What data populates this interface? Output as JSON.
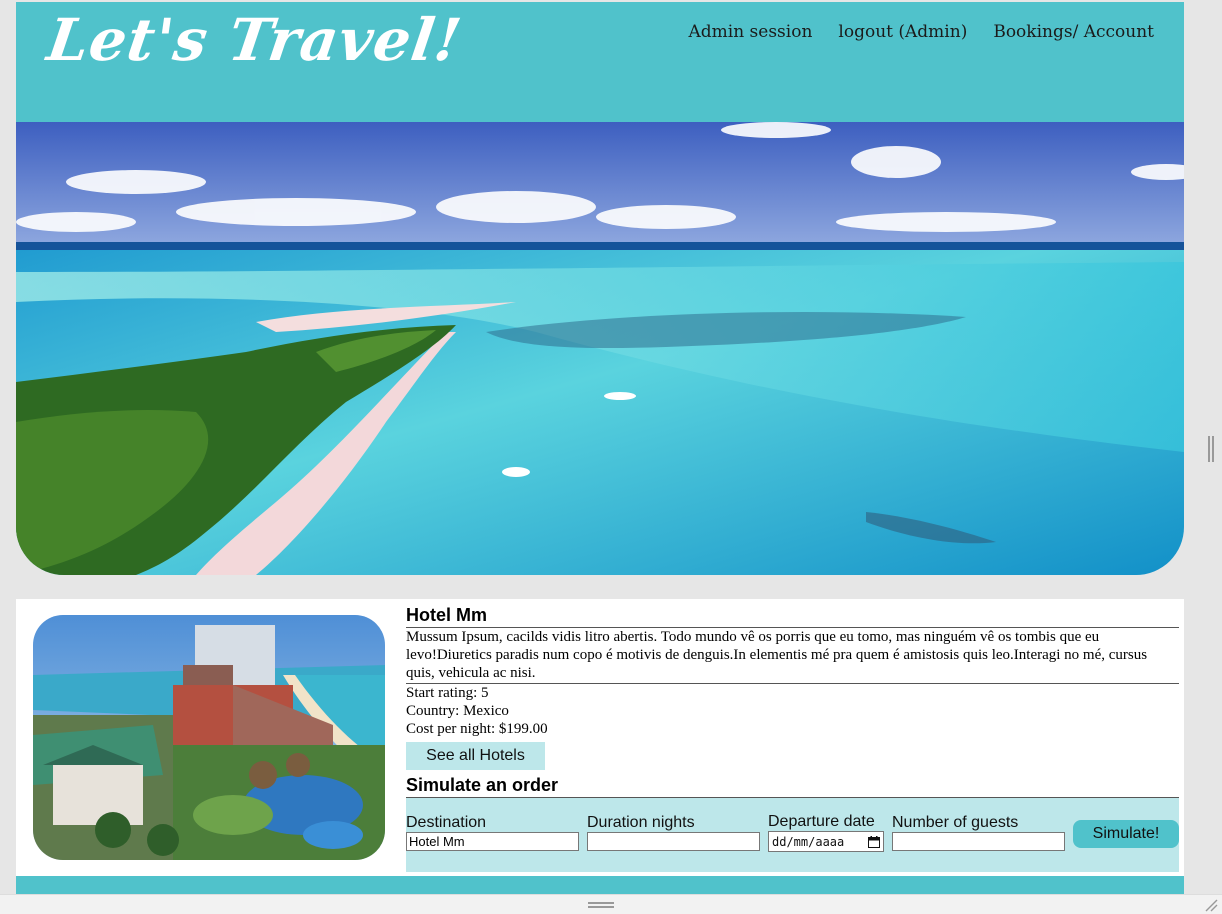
{
  "header": {
    "logo": "Let's Travel!",
    "nav": [
      "Admin session",
      "logout (Admin)",
      "Bookings/ Account"
    ]
  },
  "hotel": {
    "name": "Hotel Mm",
    "description": "Mussum Ipsum, cacilds vidis litro abertis. Todo mundo vê os porris que eu tomo, mas ninguém vê os tombis que eu levo!Diuretics paradis num copo é motivis de denguis.In elementis mé pra quem é amistosis quis leo.Interagi no mé, cursus quis, vehicula ac nisi.",
    "rating": "Start rating: 5",
    "country": "Country: Mexico",
    "cost": "Cost per night: $199.00",
    "see_all_label": "See all Hotels"
  },
  "simulate": {
    "title": "Simulate an order",
    "destination_label": "Destination",
    "destination_value": "Hotel Mm",
    "duration_label": "Duration nights",
    "duration_value": "",
    "departure_label": "Departure date",
    "departure_placeholder": "dd/mm/aaaa",
    "guests_label": "Number of guests",
    "guests_value": "",
    "button_label": "Simulate!"
  },
  "colors": {
    "accent": "#50c2cb",
    "accent_light": "#bde7ea"
  },
  "icons": {
    "calendar": "calendar-icon"
  }
}
